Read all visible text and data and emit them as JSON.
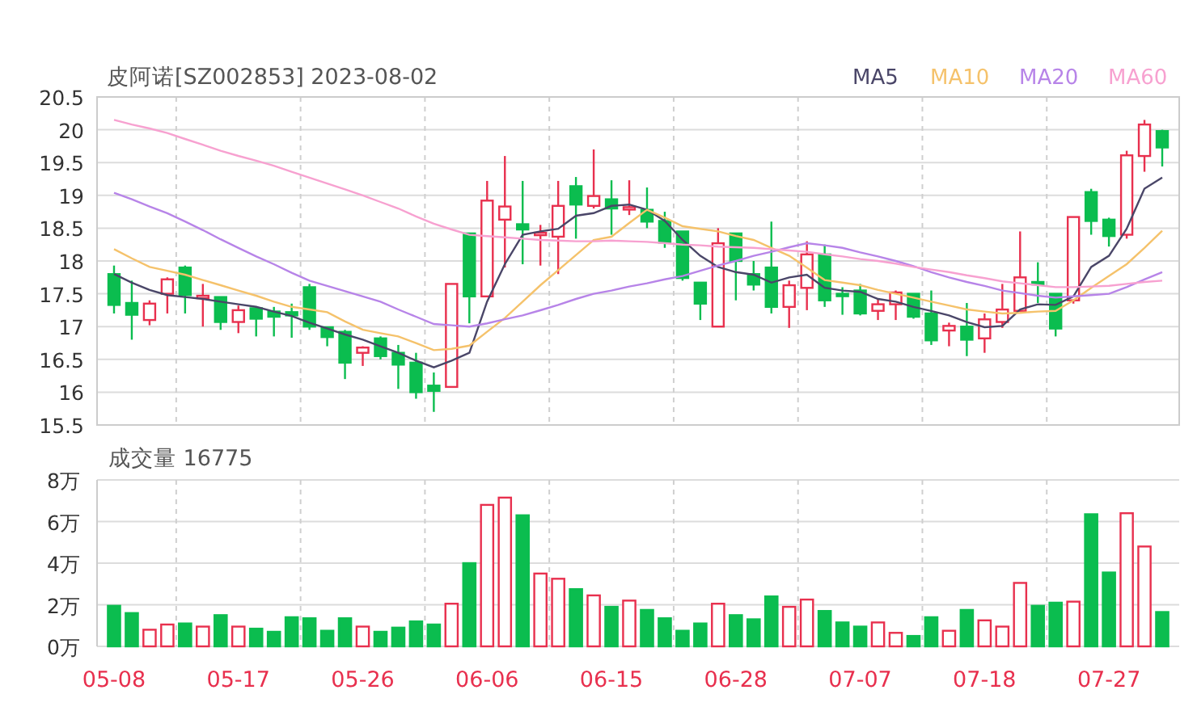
{
  "header": {
    "title": "皮阿诺[SZ002853] 2023-08-02"
  },
  "price_chart": {
    "chart_data": {
      "type": "candlestick",
      "grid": true,
      "categories": [
        null,
        null,
        null,
        null,
        null,
        null,
        null,
        null,
        null,
        null,
        null,
        null,
        null,
        null,
        null,
        null,
        null,
        null,
        null,
        null,
        null,
        null,
        null,
        null,
        null,
        null,
        null,
        null,
        null,
        null,
        null,
        null,
        null,
        null,
        null,
        null,
        null,
        null,
        null,
        null,
        null,
        null,
        null,
        null,
        null,
        null,
        null,
        null,
        null,
        null,
        null,
        null,
        null,
        null,
        null,
        null,
        null,
        null,
        null,
        null
      ],
      "ylim": [
        15.5,
        20.5
      ],
      "yticks": [
        15.5,
        16,
        16.5,
        17,
        17.5,
        18,
        18.5,
        19,
        19.5,
        20,
        20.5
      ],
      "series": [
        {
          "name": "MA5",
          "type": "line",
          "color": "#4a4668",
          "values": [
            17.8,
            17.67,
            17.56,
            17.48,
            17.45,
            17.42,
            17.38,
            17.34,
            17.3,
            17.23,
            17.16,
            17.06,
            16.97,
            16.88,
            16.8,
            16.7,
            16.6,
            16.48,
            16.38,
            16.48,
            16.6,
            17.38,
            17.95,
            18.4,
            18.45,
            18.49,
            18.69,
            18.73,
            18.84,
            18.86,
            18.78,
            18.61,
            18.32,
            18.08,
            17.91,
            17.83,
            17.79,
            17.67,
            17.75,
            17.79,
            17.59,
            17.55,
            17.53,
            17.42,
            17.38,
            17.3,
            17.24,
            17.17,
            17.07,
            16.99,
            17.01,
            17.26,
            17.34,
            17.33,
            17.46,
            17.91,
            18.08,
            18.49,
            19.1,
            19.27
          ]
        },
        {
          "name": "MA10",
          "type": "line",
          "color": "#f5c26b",
          "values": [
            18.18,
            18.04,
            17.91,
            17.85,
            17.79,
            17.71,
            17.63,
            17.55,
            17.47,
            17.38,
            17.3,
            17.26,
            17.22,
            17.08,
            16.95,
            16.9,
            16.85,
            16.75,
            16.64,
            16.66,
            16.71,
            16.92,
            17.13,
            17.38,
            17.63,
            17.86,
            18.09,
            18.32,
            18.37,
            18.58,
            18.78,
            18.66,
            18.53,
            18.49,
            18.45,
            18.38,
            18.32,
            18.2,
            18.08,
            17.9,
            17.71,
            17.67,
            17.63,
            17.56,
            17.5,
            17.44,
            17.38,
            17.32,
            17.26,
            17.23,
            17.2,
            17.21,
            17.23,
            17.24,
            17.4,
            17.59,
            17.77,
            17.95,
            18.2,
            18.46
          ]
        },
        {
          "name": "MA20",
          "type": "line",
          "color": "#b784e8",
          "values": [
            19.04,
            18.94,
            18.83,
            18.73,
            18.6,
            18.47,
            18.33,
            18.2,
            18.07,
            17.95,
            17.82,
            17.7,
            17.62,
            17.54,
            17.46,
            17.38,
            17.26,
            17.15,
            17.04,
            17.02,
            17.0,
            17.05,
            17.11,
            17.17,
            17.25,
            17.33,
            17.42,
            17.5,
            17.55,
            17.61,
            17.66,
            17.72,
            17.77,
            17.85,
            17.93,
            18.0,
            18.08,
            18.14,
            18.21,
            18.27,
            18.24,
            18.2,
            18.13,
            18.07,
            18.0,
            17.92,
            17.83,
            17.75,
            17.68,
            17.62,
            17.55,
            17.51,
            17.47,
            17.44,
            17.46,
            17.48,
            17.5,
            17.6,
            17.72,
            17.83
          ]
        },
        {
          "name": "MA60",
          "type": "line",
          "color": "#f7a1d0",
          "values": [
            20.15,
            20.08,
            20.02,
            19.95,
            19.86,
            19.77,
            19.68,
            19.6,
            19.53,
            19.45,
            19.36,
            19.27,
            19.18,
            19.09,
            19.0,
            18.9,
            18.8,
            18.68,
            18.57,
            18.48,
            18.4,
            18.38,
            18.36,
            18.34,
            18.32,
            18.31,
            18.3,
            18.3,
            18.31,
            18.3,
            18.29,
            18.27,
            18.25,
            18.24,
            18.22,
            18.21,
            18.2,
            18.18,
            18.16,
            18.14,
            18.1,
            18.07,
            18.03,
            18.0,
            17.96,
            17.91,
            17.87,
            17.83,
            17.78,
            17.74,
            17.69,
            17.66,
            17.63,
            17.6,
            17.6,
            17.61,
            17.62,
            17.65,
            17.68,
            17.7
          ]
        }
      ],
      "ohlc": [
        [
          17.8,
          17.93,
          17.2,
          17.33
        ],
        [
          17.36,
          17.7,
          16.8,
          17.18
        ],
        [
          17.1,
          17.4,
          17.02,
          17.35
        ],
        [
          17.5,
          17.75,
          17.2,
          17.72
        ],
        [
          17.9,
          17.93,
          17.2,
          17.48
        ],
        [
          17.44,
          17.65,
          17.0,
          17.47
        ],
        [
          17.45,
          17.45,
          16.95,
          17.07
        ],
        [
          17.07,
          17.32,
          16.9,
          17.25
        ],
        [
          17.28,
          17.3,
          16.85,
          17.12
        ],
        [
          17.23,
          17.3,
          16.85,
          17.15
        ],
        [
          17.22,
          17.35,
          16.83,
          17.17
        ],
        [
          17.6,
          17.65,
          16.95,
          17.0
        ],
        [
          16.99,
          17.0,
          16.7,
          16.84
        ],
        [
          16.92,
          16.95,
          16.2,
          16.45
        ],
        [
          16.6,
          16.7,
          16.4,
          16.68
        ],
        [
          16.82,
          16.85,
          16.5,
          16.55
        ],
        [
          16.6,
          16.72,
          16.05,
          16.42
        ],
        [
          16.45,
          16.6,
          15.9,
          16.0
        ],
        [
          16.1,
          16.3,
          15.7,
          16.02
        ],
        [
          16.08,
          17.65,
          16.08,
          17.65
        ],
        [
          18.42,
          18.42,
          17.05,
          17.46
        ],
        [
          17.46,
          19.22,
          17.46,
          18.92
        ],
        [
          18.63,
          19.6,
          17.9,
          18.83
        ],
        [
          18.56,
          19.22,
          17.95,
          18.48
        ],
        [
          18.4,
          18.55,
          17.93,
          18.43
        ],
        [
          18.37,
          19.22,
          17.8,
          18.84
        ],
        [
          19.14,
          19.28,
          18.34,
          18.86
        ],
        [
          18.84,
          19.7,
          18.8,
          18.99
        ],
        [
          18.94,
          19.23,
          18.4,
          18.8
        ],
        [
          18.8,
          19.23,
          18.7,
          18.82
        ],
        [
          18.78,
          19.12,
          18.5,
          18.6
        ],
        [
          18.61,
          18.75,
          18.2,
          18.28
        ],
        [
          18.45,
          18.45,
          17.7,
          17.74
        ],
        [
          17.67,
          17.68,
          17.1,
          17.35
        ],
        [
          17.0,
          18.5,
          17.0,
          18.27
        ],
        [
          18.42,
          18.42,
          17.4,
          18.0
        ],
        [
          17.8,
          18.0,
          17.55,
          17.64
        ],
        [
          17.9,
          18.6,
          17.2,
          17.3
        ],
        [
          17.3,
          17.7,
          16.98,
          17.63
        ],
        [
          17.59,
          18.3,
          17.25,
          18.1
        ],
        [
          18.1,
          18.25,
          17.3,
          17.4
        ],
        [
          17.5,
          17.6,
          17.18,
          17.47
        ],
        [
          17.55,
          17.65,
          17.17,
          17.2
        ],
        [
          17.24,
          17.42,
          17.1,
          17.34
        ],
        [
          17.34,
          17.55,
          17.1,
          17.52
        ],
        [
          17.5,
          17.5,
          17.12,
          17.15
        ],
        [
          17.2,
          17.55,
          16.72,
          16.79
        ],
        [
          16.94,
          17.06,
          16.7,
          17.01
        ],
        [
          17.0,
          17.36,
          16.55,
          16.8
        ],
        [
          16.82,
          17.2,
          16.6,
          17.11
        ],
        [
          17.07,
          17.65,
          16.98,
          17.26
        ],
        [
          17.24,
          18.45,
          17.24,
          17.75
        ],
        [
          17.68,
          17.98,
          17.36,
          17.65
        ],
        [
          17.5,
          17.5,
          16.85,
          16.97
        ],
        [
          17.4,
          18.67,
          17.35,
          18.67
        ],
        [
          19.05,
          19.1,
          18.4,
          18.61
        ],
        [
          18.63,
          18.66,
          18.22,
          18.38
        ],
        [
          18.4,
          19.68,
          18.34,
          19.61
        ],
        [
          19.6,
          20.15,
          19.36,
          20.08
        ],
        [
          19.98,
          20.0,
          19.44,
          19.73
        ]
      ]
    }
  },
  "volume_chart": {
    "chart_data": {
      "type": "bar",
      "grid": true,
      "title": "成交量 16775",
      "ylim": [
        0,
        8
      ],
      "categories": [
        "05-08",
        null,
        null,
        null,
        null,
        null,
        null,
        "05-17",
        null,
        null,
        null,
        null,
        null,
        null,
        "05-26",
        null,
        null,
        null,
        null,
        null,
        null,
        "06-06",
        null,
        null,
        null,
        null,
        null,
        null,
        "06-15",
        null,
        null,
        null,
        null,
        null,
        null,
        "06-28",
        null,
        null,
        null,
        null,
        null,
        null,
        "07-07",
        null,
        null,
        null,
        null,
        null,
        null,
        "07-18",
        null,
        null,
        null,
        null,
        null,
        null,
        "07-27",
        null,
        null,
        null
      ],
      "yticks": [
        {
          "value": 0,
          "label": "0万"
        },
        {
          "value": 2,
          "label": "2万"
        },
        {
          "value": 4,
          "label": "4万"
        },
        {
          "value": 6,
          "label": "6万"
        },
        {
          "value": 8,
          "label": "8万"
        }
      ],
      "values": [
        1.95,
        1.6,
        0.8,
        1.05,
        1.1,
        0.95,
        1.5,
        0.95,
        0.85,
        0.7,
        1.4,
        1.35,
        0.75,
        1.35,
        0.95,
        0.7,
        0.9,
        1.2,
        1.05,
        2.05,
        4.0,
        6.8,
        7.15,
        6.3,
        3.5,
        3.25,
        2.75,
        2.45,
        1.9,
        2.2,
        1.75,
        1.35,
        0.75,
        1.1,
        2.05,
        1.5,
        1.3,
        2.4,
        1.9,
        2.25,
        1.7,
        1.15,
        0.95,
        1.15,
        0.65,
        0.5,
        1.4,
        0.75,
        1.75,
        1.25,
        0.95,
        3.05,
        1.95,
        2.1,
        2.15,
        6.35,
        3.55,
        6.4,
        4.8,
        1.65
      ]
    }
  }
}
